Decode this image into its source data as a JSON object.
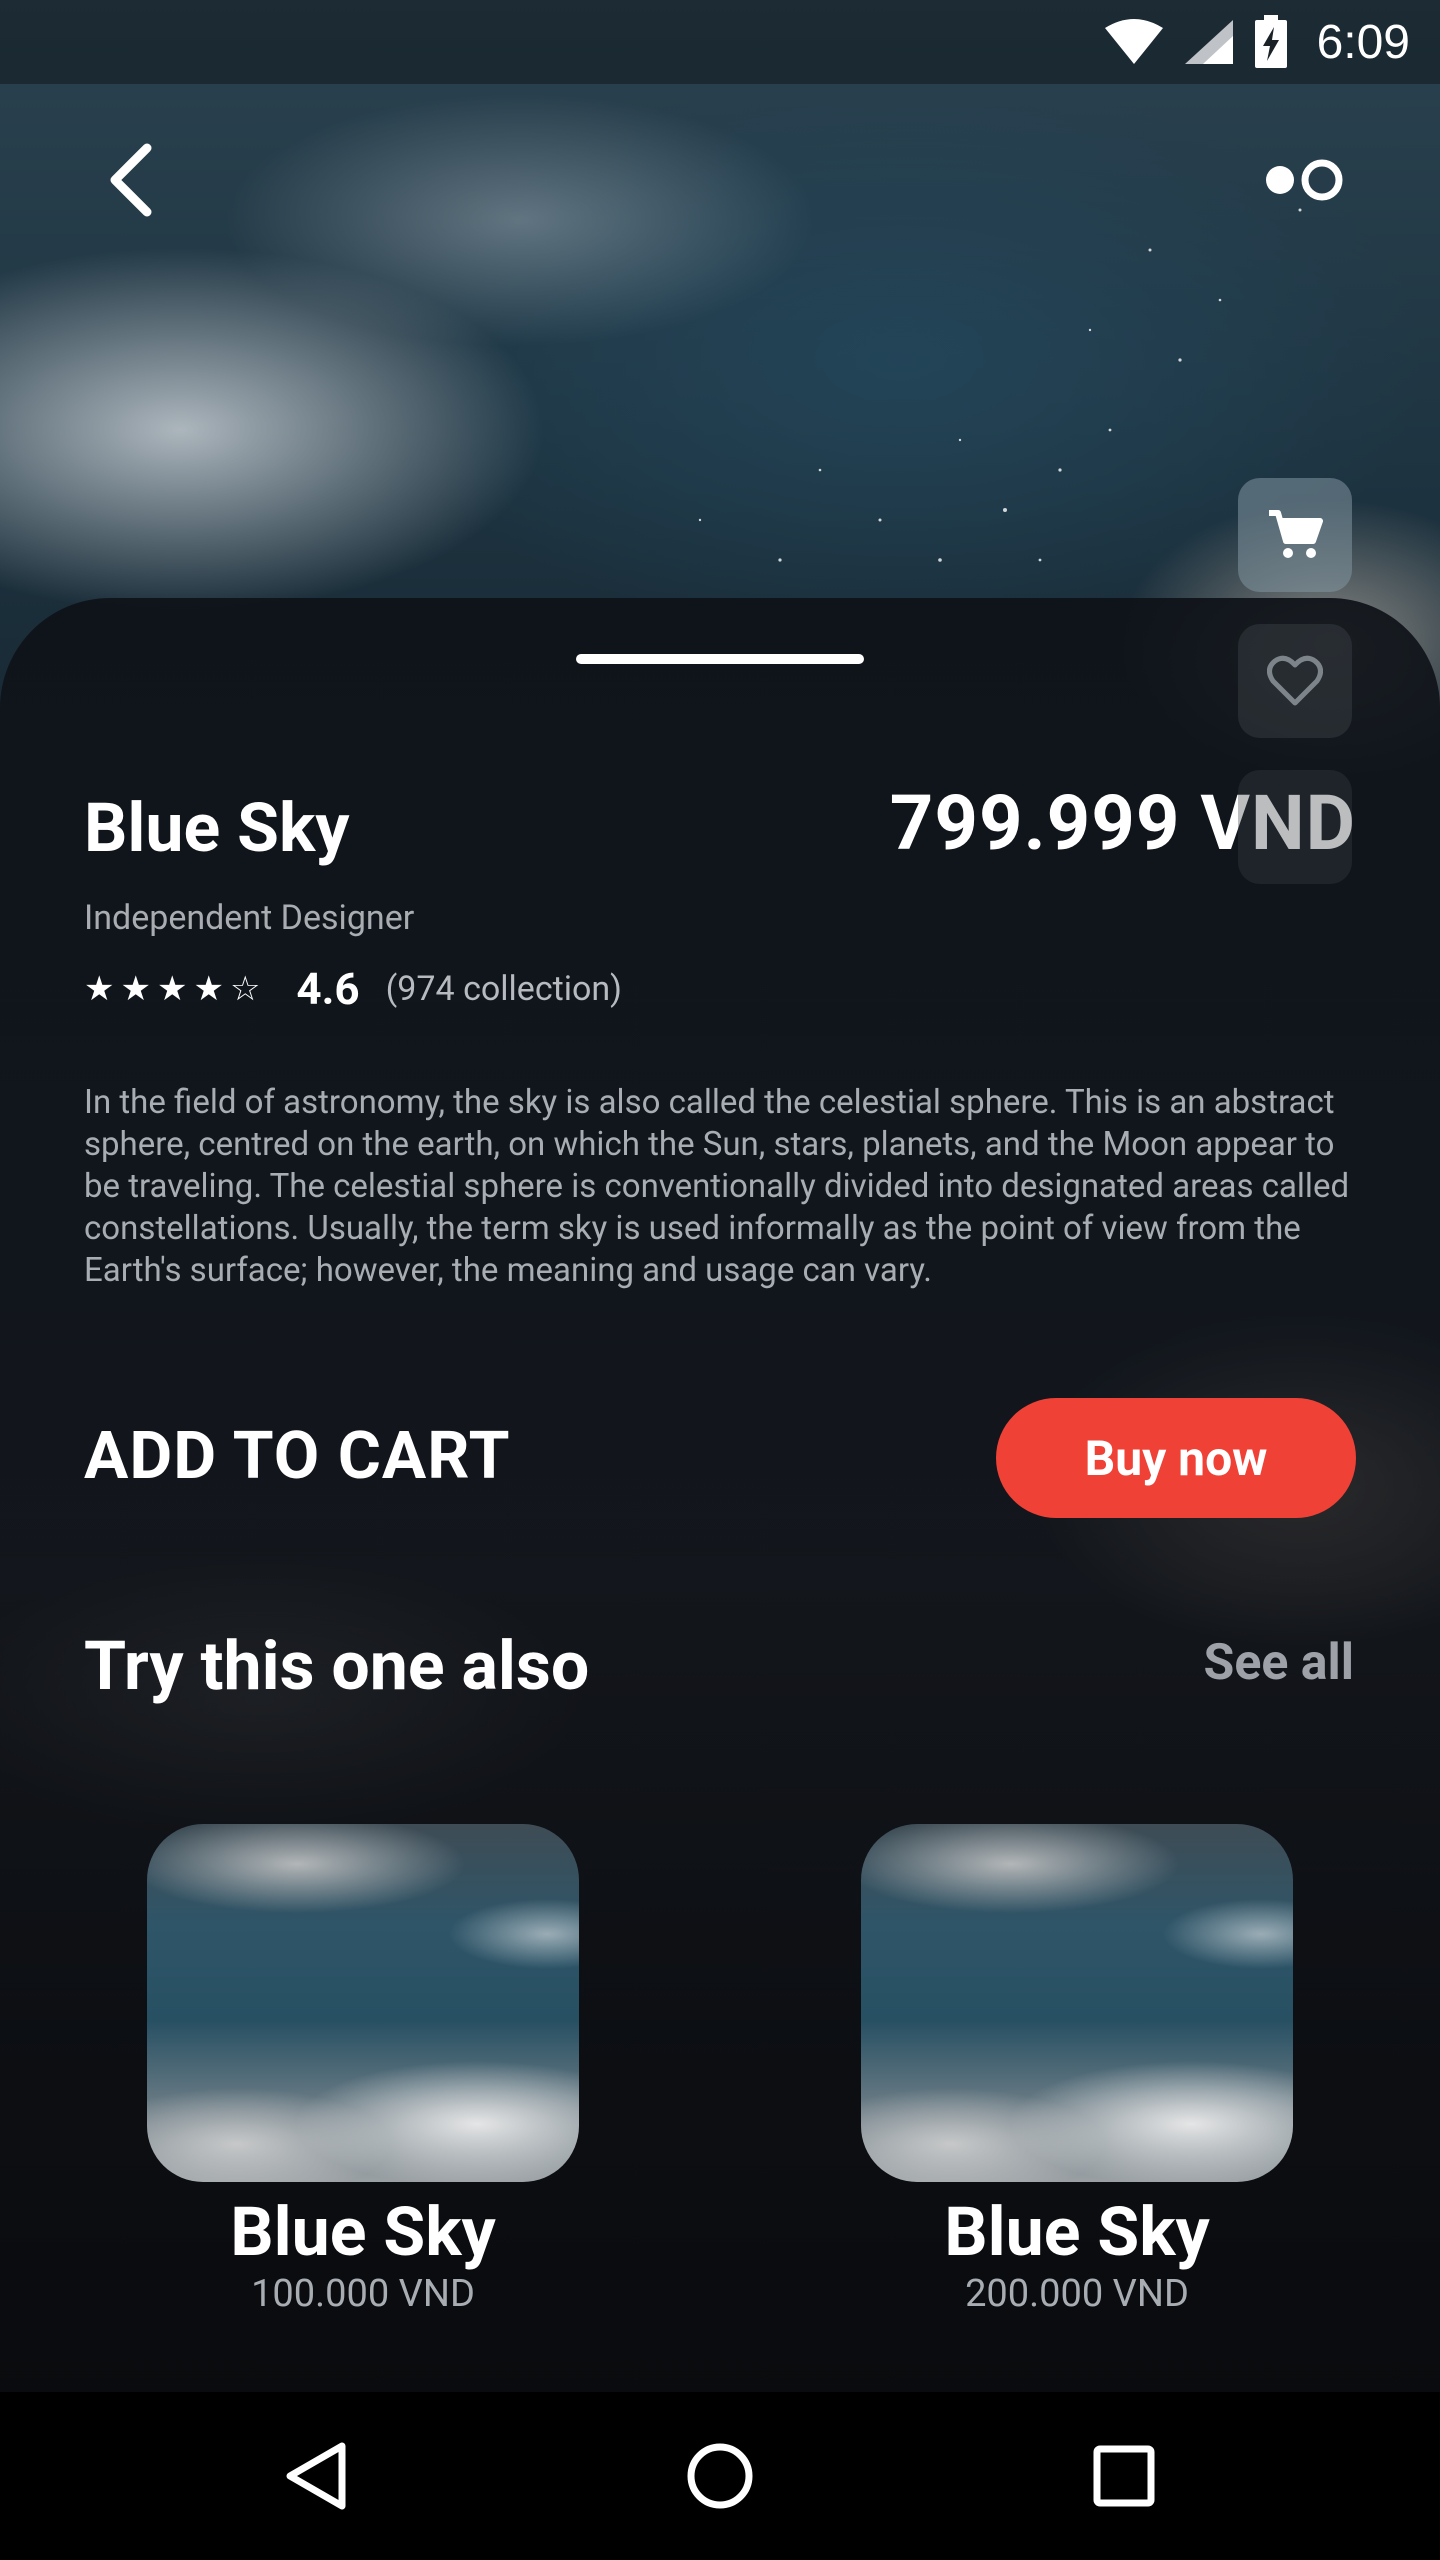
{
  "status_bar": {
    "time": "6:09",
    "icons": [
      "wifi-icon",
      "signal-icon",
      "battery-charging-icon"
    ]
  },
  "top_bar": {
    "back_icon": "back-chevron-icon",
    "more_icon": "toggle-dots-icon"
  },
  "side_actions": [
    "cart-icon",
    "heart-icon"
  ],
  "product": {
    "title": "Blue Sky",
    "price": "799.999 VND",
    "designer": "Independent Designer",
    "stars": [
      "★",
      "★",
      "★",
      "★",
      "☆"
    ],
    "rating": "4.6",
    "rating_count": "(974 collection)",
    "description": "In the field of astronomy, the sky is also called the celestial sphere. This is an abstract sphere, centred on the earth, on which the Sun, stars, planets, and the Moon appear to be traveling. The celestial sphere is conventionally divided into designated areas called constellations. Usually, the term sky is used informally as the point of view from the Earth's surface; however, the meaning and usage can vary."
  },
  "actions": {
    "add_to_cart": "ADD TO CART",
    "buy_now": "Buy now"
  },
  "related": {
    "title": "Try this one also",
    "see_all": "See all",
    "items": [
      {
        "title": "Blue Sky",
        "price": "100.000 VND"
      },
      {
        "title": "Blue Sky",
        "price": "200.000 VND"
      }
    ]
  },
  "colors": {
    "accent": "#ef4136",
    "muted_text": "#a8adb3",
    "background": "#0b0e13"
  },
  "nav_bar": [
    "nav-back-icon",
    "nav-home-icon",
    "nav-recents-icon"
  ]
}
